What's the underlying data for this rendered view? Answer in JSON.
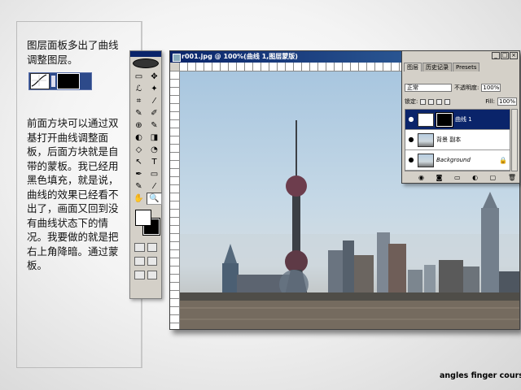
{
  "note": {
    "line1": "图层面板多出了曲线调整图层。",
    "line2": "前面方块可以通过双基打开曲线调整面板，后面方块就是自带的蒙板。我已经用黑色填充，就是说，曲线的效果已经看不出了，画面又回到没有曲线状态下的情况。我要做的就是把右上角降暗。通过蒙板。"
  },
  "document": {
    "title": "r001.jpg @ 100%(曲线 1,图层蒙版)"
  },
  "toolbox": {
    "tools": [
      "▭",
      "✥",
      "ℒ",
      "✦",
      "⌗",
      "⁄",
      "✎",
      "✐",
      "⊕",
      "✎",
      "◐",
      "◨",
      "◇",
      "◔",
      "↖",
      "T",
      "✒",
      "▭",
      "✎",
      "⁄",
      "✋",
      "🔍"
    ]
  },
  "layers_panel": {
    "tabs": [
      "图层",
      "历史记录",
      "Presets"
    ],
    "blend_mode": "正常",
    "opacity_label": "不透明度:",
    "opacity_value": "100%",
    "lock_label": "锁定:",
    "fill_label": "Fill:",
    "fill_value": "100%",
    "layers": [
      {
        "name": "曲线 1",
        "active": true
      },
      {
        "name": "背景 副本",
        "active": false
      },
      {
        "name": "Background",
        "active": false,
        "locked": true
      }
    ]
  },
  "footer": {
    "credit": "angles finger course"
  },
  "colors": {
    "titlebar": "#0a246a",
    "panel_bg": "#d4d0c8",
    "selected_layer": "#0a246a"
  }
}
